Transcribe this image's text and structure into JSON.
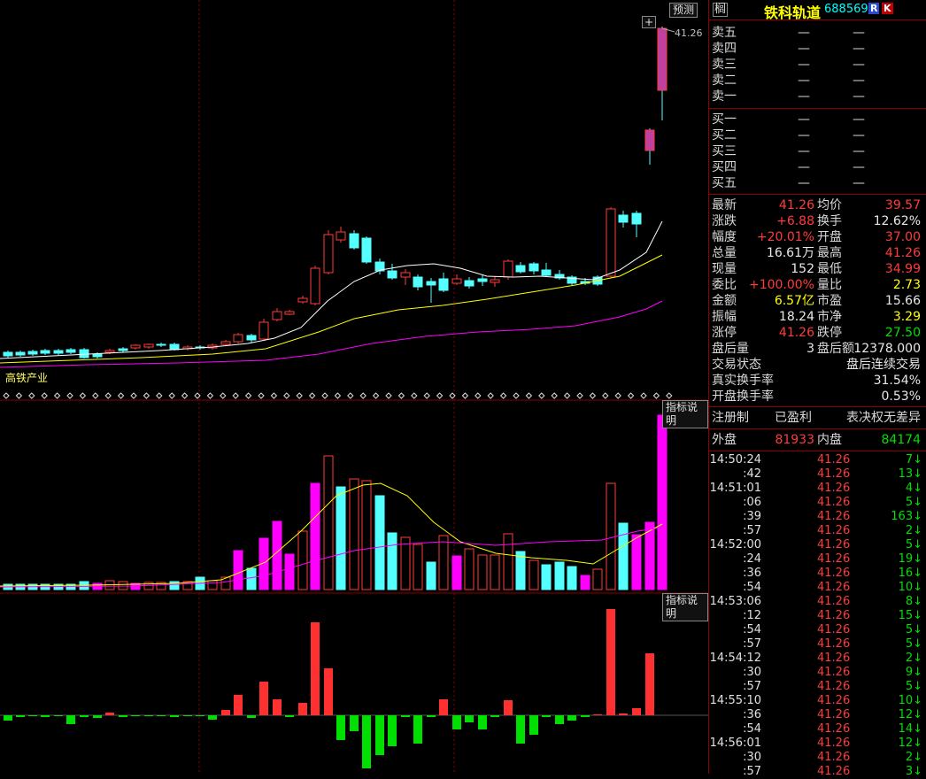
{
  "chart": {
    "price_label": "41.26",
    "forecast_button": "预测",
    "plus_icon": "+",
    "sector_label": "高铁产业",
    "indicator_button_1": "指标说明",
    "indicator_button_2": "指标说明",
    "colors": {
      "up": "#ff3b3b",
      "down": "#54ffff",
      "ma5": "#ffffff",
      "ma10": "#ffff00",
      "ma20": "#ff00ff",
      "grid": "#8b0000"
    }
  },
  "quote": {
    "tag": "榈",
    "name": "铁科轨道",
    "code": "688569",
    "badge_r": "R",
    "badge_k": "K",
    "asks": [
      {
        "label": "卖五",
        "price": "—",
        "vol": "—"
      },
      {
        "label": "卖四",
        "price": "—",
        "vol": "—"
      },
      {
        "label": "卖三",
        "price": "—",
        "vol": "—"
      },
      {
        "label": "卖二",
        "price": "—",
        "vol": "—"
      },
      {
        "label": "卖一",
        "price": "—",
        "vol": "—"
      }
    ],
    "bids": [
      {
        "label": "买一",
        "price": "—",
        "vol": "—"
      },
      {
        "label": "买二",
        "price": "—",
        "vol": "—"
      },
      {
        "label": "买三",
        "price": "—",
        "vol": "—"
      },
      {
        "label": "买四",
        "price": "—",
        "vol": "—"
      },
      {
        "label": "买五",
        "price": "—",
        "vol": "—"
      }
    ],
    "stats": [
      {
        "l1": "最新",
        "v1": "41.26",
        "c1": "red",
        "l2": "均价",
        "v2": "39.57",
        "c2": "red"
      },
      {
        "l1": "涨跌",
        "v1": "+6.88",
        "c1": "red",
        "l2": "换手",
        "v2": "12.62%",
        "c2": "white"
      },
      {
        "l1": "幅度",
        "v1": "+20.01%",
        "c1": "red",
        "l2": "开盘",
        "v2": "37.00",
        "c2": "red"
      },
      {
        "l1": "总量",
        "v1": "16.61万",
        "c1": "white",
        "l2": "最高",
        "v2": "41.26",
        "c2": "red"
      },
      {
        "l1": "现量",
        "v1": "152",
        "c1": "white",
        "l2": "最低",
        "v2": "34.99",
        "c2": "red"
      },
      {
        "l1": "委比",
        "v1": "+100.00%",
        "c1": "red",
        "l2": "量比",
        "v2": "2.73",
        "c2": "yellow"
      },
      {
        "l1": "金额",
        "v1": "6.57亿",
        "c1": "yellow",
        "l2": "市盈",
        "v2": "15.66",
        "c2": "white"
      },
      {
        "l1": "振幅",
        "v1": "18.24",
        "c1": "white",
        "l2": "市净",
        "v2": "3.29",
        "c2": "yellow"
      },
      {
        "l1": "涨停",
        "v1": "41.26",
        "c1": "red",
        "l2": "跌停",
        "v2": "27.50",
        "c2": "green"
      }
    ],
    "after_hours_vol_label": "盘后量",
    "after_hours_vol": "3",
    "after_hours_amt_label": "盘后额",
    "after_hours_amt": "12378.000",
    "trade_status_label": "交易状态",
    "trade_status": "盘后连续交易",
    "real_turnover_label": "真实换手率",
    "real_turnover": "31.54%",
    "open_turnover_label": "开盘换手率",
    "open_turnover": "0.53%",
    "tags": [
      "注册制",
      "已盈利",
      "表决权无差异"
    ],
    "outer_label": "外盘",
    "outer": "81933",
    "inner_label": "内盘",
    "inner": "84174",
    "ticks": [
      {
        "t": "14:50:24",
        "p": "41.26",
        "v": "7↓"
      },
      {
        "t": ":42",
        "p": "41.26",
        "v": "13↓"
      },
      {
        "t": "14:51:01",
        "p": "41.26",
        "v": "4↓"
      },
      {
        "t": ":06",
        "p": "41.26",
        "v": "5↓"
      },
      {
        "t": ":39",
        "p": "41.26",
        "v": "163↓"
      },
      {
        "t": ":57",
        "p": "41.26",
        "v": "2↓"
      },
      {
        "t": "14:52:00",
        "p": "41.26",
        "v": "5↓"
      },
      {
        "t": ":24",
        "p": "41.26",
        "v": "19↓"
      },
      {
        "t": ":36",
        "p": "41.26",
        "v": "16↓"
      },
      {
        "t": ":54",
        "p": "41.26",
        "v": "10↓"
      },
      {
        "t": "14:53:06",
        "p": "41.26",
        "v": "8↓"
      },
      {
        "t": ":12",
        "p": "41.26",
        "v": "15↓"
      },
      {
        "t": ":54",
        "p": "41.26",
        "v": "5↓"
      },
      {
        "t": ":57",
        "p": "41.26",
        "v": "5↓"
      },
      {
        "t": "14:54:12",
        "p": "41.26",
        "v": "2↓"
      },
      {
        "t": ":30",
        "p": "41.26",
        "v": "9↓"
      },
      {
        "t": ":57",
        "p": "41.26",
        "v": "5↓"
      },
      {
        "t": "14:55:10",
        "p": "41.26",
        "v": "10↓"
      },
      {
        "t": ":36",
        "p": "41.26",
        "v": "12↓"
      },
      {
        "t": ":54",
        "p": "41.26",
        "v": "14↓"
      },
      {
        "t": "14:56:01",
        "p": "41.26",
        "v": "12↓"
      },
      {
        "t": ":30",
        "p": "41.26",
        "v": "2↓"
      },
      {
        "t": ":57",
        "p": "41.26",
        "v": "3↓"
      }
    ]
  }
}
